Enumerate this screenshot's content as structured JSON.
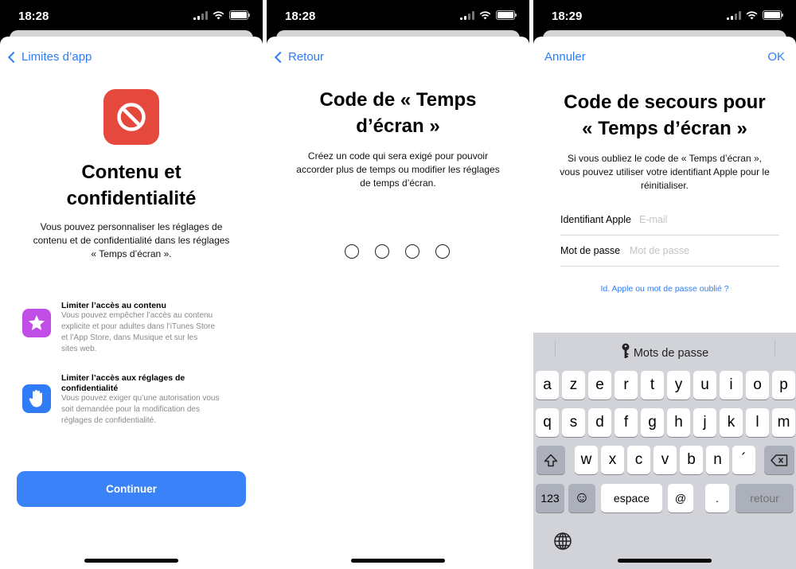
{
  "screens": [
    {
      "time": "18:28",
      "nav": {
        "back_label": "Limites d’app"
      },
      "icon": "prohibited-icon",
      "title_line1": "Contenu et",
      "title_line2": "confidentialité",
      "description": [
        "Vous pouvez personnaliser les réglages de",
        "contenu et de confidentialité dans les réglages",
        "« Temps d’écran »."
      ],
      "features": [
        {
          "icon": "star-icon",
          "color": "#c04de6",
          "title": "Limiter l’accès au contenu",
          "desc": [
            "Vous pouvez empêcher l’accès au contenu",
            "explicite et pour adultes dans l’iTunes Store",
            "et l’App Store, dans Musique et sur les",
            "sites web."
          ]
        },
        {
          "icon": "hand-icon",
          "color": "#2f7cf6",
          "title_line1": "Limiter l’accès aux réglages de",
          "title_line2": "confidentialité",
          "desc": [
            "Vous pouvez exiger qu’une autorisation vous",
            "soit demandée pour la modification des",
            "réglages de confidentialité."
          ]
        }
      ],
      "button_label": "Continuer"
    },
    {
      "time": "18:28",
      "nav": {
        "back_label": "Retour"
      },
      "title_line1": "Code de « Temps",
      "title_line2": "d’écran »",
      "description": [
        "Créez un code qui sera exigé pour pouvoir",
        "accorder plus de temps ou modifier les réglages",
        "de temps d’écran."
      ],
      "passcode_length": 4
    },
    {
      "time": "18:29",
      "nav": {
        "cancel_label": "Annuler",
        "ok_label": "OK"
      },
      "title_line1": "Code de secours pour",
      "title_line2": "« Temps d’écran »",
      "description": [
        "Si vous oubliez le code de « Temps d’écran »,",
        "vous pouvez utiliser votre identifiant Apple pour le",
        "réinitialiser."
      ],
      "fields": [
        {
          "label": "Identifiant Apple",
          "placeholder": "E-mail"
        },
        {
          "label": "Mot de passe",
          "placeholder": "Mot de passe"
        }
      ],
      "forgot_link": "Id. Apple ou mot de passe oublié ?",
      "keyboard": {
        "suggestion": "Mots de passe",
        "row1": [
          "a",
          "z",
          "e",
          "r",
          "t",
          "y",
          "u",
          "i",
          "o",
          "p"
        ],
        "row2": [
          "q",
          "s",
          "d",
          "f",
          "g",
          "h",
          "j",
          "k",
          "l",
          "m"
        ],
        "row3": [
          "w",
          "x",
          "c",
          "v",
          "b",
          "n",
          "´"
        ],
        "key_123": "123",
        "emoji": "☺",
        "space": "espace",
        "at": "@",
        "dot": ".",
        "return": "retour"
      }
    }
  ]
}
